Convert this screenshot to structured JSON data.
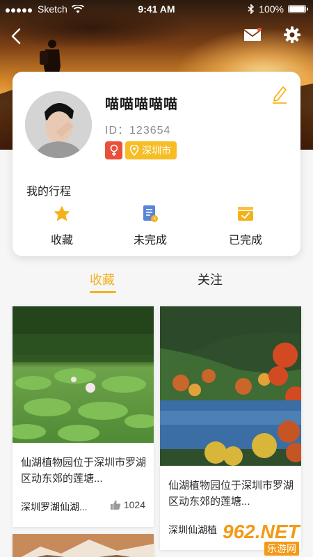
{
  "status_bar": {
    "carrier": "Sketch",
    "time": "9:41 AM",
    "battery": "100%"
  },
  "profile": {
    "nickname": "喵喵喵喵喵",
    "id_label": "ID：",
    "id_value": "123654",
    "city": "深圳市"
  },
  "trips": {
    "title": "我的行程",
    "items": [
      {
        "label": "收藏",
        "icon": "star-icon"
      },
      {
        "label": "未完成",
        "icon": "document-pending-icon"
      },
      {
        "label": "已完成",
        "icon": "check-inbox-icon"
      }
    ]
  },
  "tabs": [
    {
      "label": "收藏",
      "active": true
    },
    {
      "label": "关注",
      "active": false
    }
  ],
  "feed": [
    {
      "desc": "仙湖植物园位于深圳市罗湖区动东郊的莲塘...",
      "location": "深圳罗湖仙湖...",
      "likes": "1024"
    },
    {
      "desc": "仙湖植物园位于深圳市罗湖区动东郊的莲塘...",
      "location": "深圳仙湖植"
    }
  ],
  "watermark": {
    "brand": "962.NET",
    "sub": "乐游网"
  },
  "colors": {
    "accent": "#f4b21a",
    "gender_badge": "#e9503c",
    "city_badge": "#f6bd25"
  }
}
